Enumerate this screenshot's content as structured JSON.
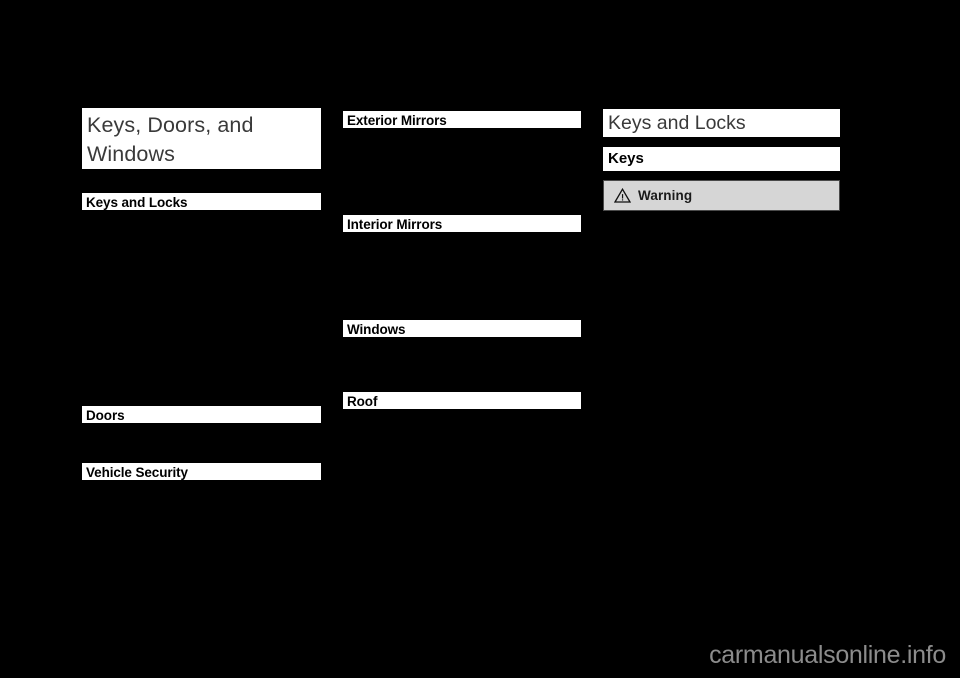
{
  "document": {
    "background_color": "#000000",
    "box_color": "#ffffff",
    "warning_background_color": "#d6d6d6",
    "watermark": "carmanualsonline.info"
  },
  "column_left": {
    "chapter_title": "Keys, Doors, and Windows",
    "toc_entries": [
      {
        "label": "Keys and Locks"
      },
      {
        "label": "Doors"
      },
      {
        "label": "Vehicle Security"
      }
    ]
  },
  "column_middle": {
    "toc_entries": [
      {
        "label": "Exterior Mirrors"
      },
      {
        "label": "Interior Mirrors"
      },
      {
        "label": "Windows"
      },
      {
        "label": "Roof"
      }
    ]
  },
  "column_right": {
    "section_title": "Keys and Locks",
    "subsection_title": "Keys",
    "warning": {
      "icon": "warning-triangle-icon",
      "label": "Warning"
    }
  }
}
